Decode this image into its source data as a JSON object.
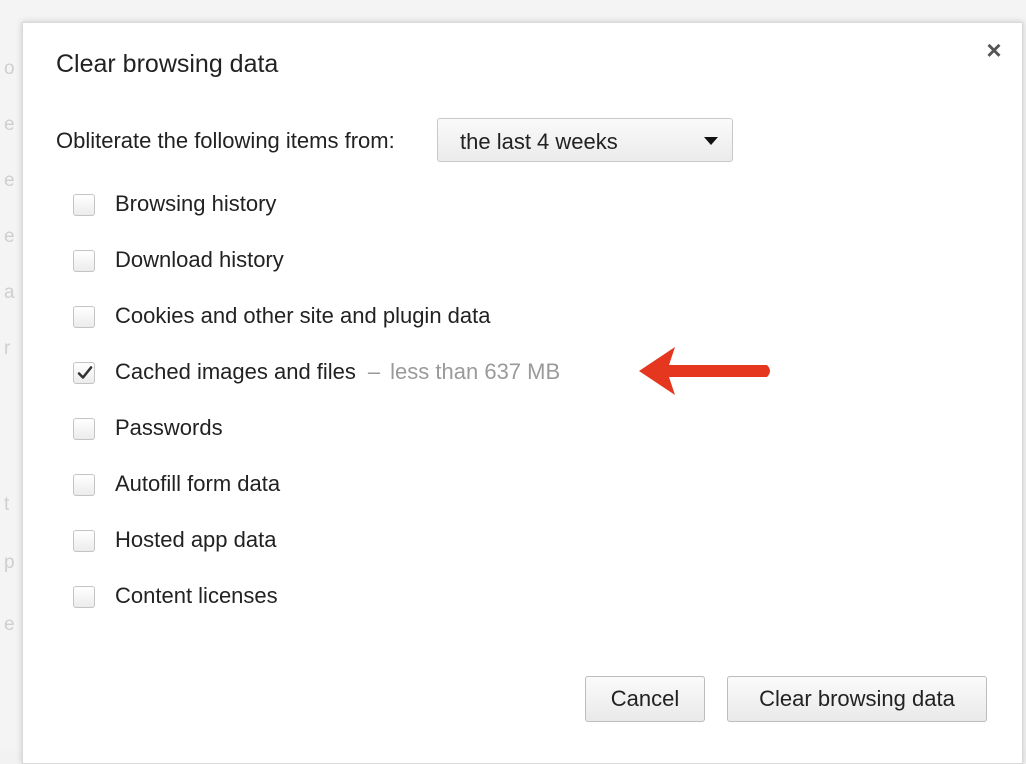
{
  "background_fragments": [
    "o",
    "e",
    "e",
    "e",
    "a",
    "r",
    "t",
    "p",
    "e"
  ],
  "dialog": {
    "title": "Clear browsing data",
    "close_glyph": "×",
    "range_label": "Obliterate the following items from:",
    "range_value": "the last 4 weeks",
    "items": [
      {
        "label": "Browsing history",
        "checked": false,
        "extra": ""
      },
      {
        "label": "Download history",
        "checked": false,
        "extra": ""
      },
      {
        "label": "Cookies and other site and plugin data",
        "checked": false,
        "extra": ""
      },
      {
        "label": "Cached images and files",
        "checked": true,
        "dash": "–",
        "extra": "less than 637 MB"
      },
      {
        "label": "Passwords",
        "checked": false,
        "extra": ""
      },
      {
        "label": "Autofill form data",
        "checked": false,
        "extra": ""
      },
      {
        "label": "Hosted app data",
        "checked": false,
        "extra": ""
      },
      {
        "label": "Content licenses",
        "checked": false,
        "extra": ""
      }
    ],
    "cancel_label": "Cancel",
    "clear_label": "Clear browsing data"
  },
  "annotation": {
    "arrow_icon": "left-arrow-icon",
    "arrow_color": "#e5361f"
  }
}
